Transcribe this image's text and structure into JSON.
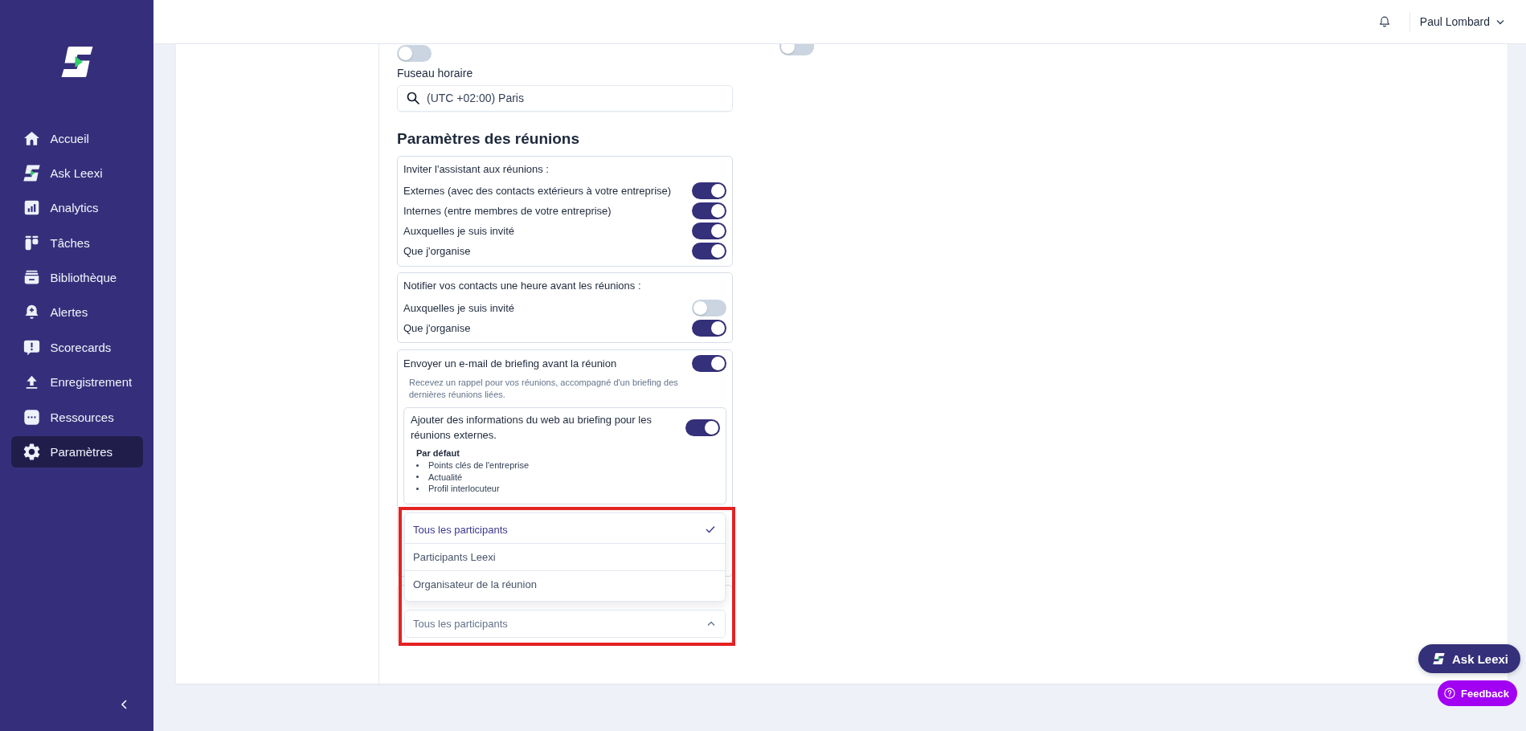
{
  "sidebar": {
    "items": [
      {
        "label": "Accueil",
        "selected": false
      },
      {
        "label": "Ask Leexi",
        "selected": false
      },
      {
        "label": "Analytics",
        "selected": false
      },
      {
        "label": "Tâches",
        "selected": false
      },
      {
        "label": "Bibliothèque",
        "selected": false
      },
      {
        "label": "Alertes",
        "selected": false
      },
      {
        "label": "Scorecards",
        "selected": false
      },
      {
        "label": "Enregistrement",
        "selected": false
      },
      {
        "label": "Ressources",
        "selected": false
      },
      {
        "label": "Paramètres",
        "selected": true
      }
    ]
  },
  "header": {
    "user_name": "Paul Lombard"
  },
  "settings": {
    "top_toggles": [
      {
        "on": false
      },
      {
        "on": false
      }
    ],
    "timezone": {
      "label": "Fuseau horaire",
      "value": "(UTC +02:00) Paris"
    },
    "section_title": "Paramètres des réunions",
    "invite_group": {
      "title": "Inviter l'assistant aux réunions :",
      "options": [
        {
          "label": "Externes (avec des contacts extérieurs à votre entreprise)",
          "on": true
        },
        {
          "label": "Internes (entre membres de votre entreprise)",
          "on": true
        },
        {
          "label": "Auxquelles je suis invité",
          "on": true
        },
        {
          "label": "Que j'organise",
          "on": true
        }
      ]
    },
    "notify_group": {
      "title": "Notifier vos contacts une heure avant les réunions :",
      "options": [
        {
          "label": "Auxquelles je suis invité",
          "on": false
        },
        {
          "label": "Que j'organise",
          "on": true
        }
      ]
    },
    "briefing": {
      "label": "Envoyer un e-mail de briefing avant la réunion",
      "on": true,
      "description": "Recevez un rappel pour vos réunions, accompagné d'un briefing des dernières réunions liées.",
      "web_info": {
        "label": "Ajouter des informations du web au briefing pour les réunions externes.",
        "on": true,
        "default_title": "Par défaut",
        "default_items": [
          "Points clés de l'entreprise",
          "Actualité",
          "Profil interlocuteur"
        ]
      }
    },
    "participants_select": {
      "value": "Tous les participants",
      "expanded": true,
      "highlighted": true,
      "options": [
        {
          "label": "Tous les participants",
          "selected": true
        },
        {
          "label": "Participants Leexi",
          "selected": false
        },
        {
          "label": "Organisateur de la réunion",
          "selected": false
        }
      ]
    }
  },
  "floating_buttons": [
    {
      "label": "Ask Leexi",
      "kind": "assistant"
    },
    {
      "label": "Feedback",
      "kind": "feedback"
    }
  ]
}
